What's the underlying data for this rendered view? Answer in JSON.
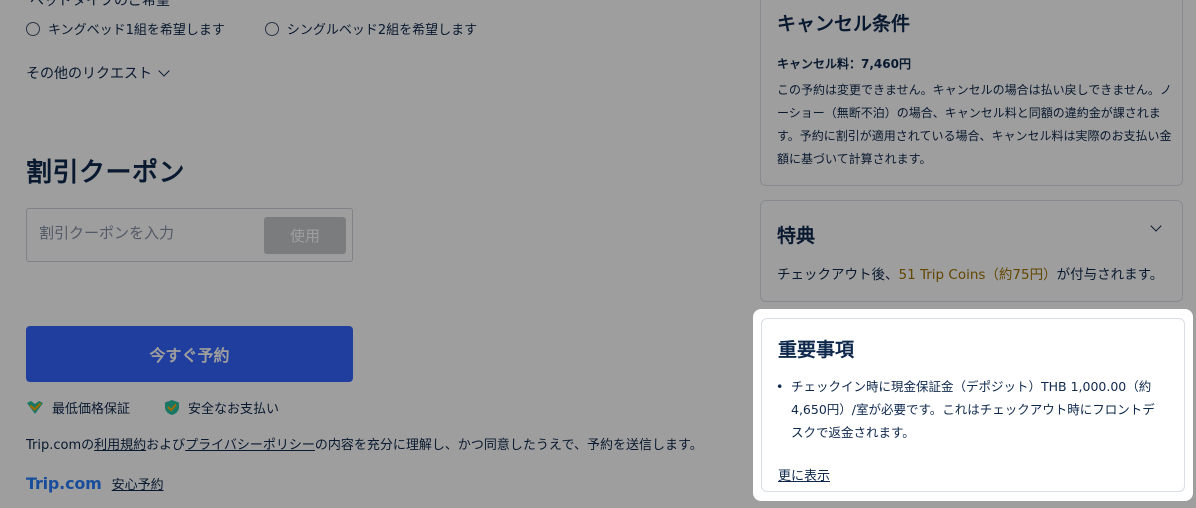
{
  "bed": {
    "heading_cut": "ベッドタイプのご希望",
    "options": [
      {
        "label": "キングベッド1組を希望します"
      },
      {
        "label": "シングルベッド2組を希望します"
      }
    ],
    "other_requests": "その他のリクエスト"
  },
  "coupon": {
    "title": "割引クーポン",
    "placeholder": "割引クーポンを入力",
    "apply_label": "使用"
  },
  "book": {
    "button_label": "今すぐ予約",
    "badges": [
      {
        "label": "最低価格保証",
        "icon": "heart-check-icon"
      },
      {
        "label": "安全なお支払い",
        "icon": "shield-check-icon"
      }
    ],
    "terms_prefix": "Trip.comの",
    "terms_link1": "利用規約",
    "terms_mid": "および",
    "terms_link2": "プライバシーポリシー",
    "terms_suffix": "の内容を充分に理解し、かつ同意したうえで、予約を送信します。",
    "brand": "Trip.com",
    "safe_link": "安心予約"
  },
  "cancel": {
    "title": "キャンセル条件",
    "fee": "キャンセル料：7,460円",
    "body": "この予約は変更できません。キャンセルの場合は払い戻しできません。ノーショー（無断不泊）の場合、キャンセル料と同額の違約金が課されます。予約に割引が適用されている場合、キャンセル料は実際のお支払い金額に基づいて計算されます。"
  },
  "perks": {
    "title": "特典",
    "prefix": "チェックアウト後、",
    "coins": "51 Trip Coins（約75円）",
    "suffix": "が付与されます。"
  },
  "important": {
    "title": "重要事項",
    "items": [
      {
        "text": "チェックイン時に現金保証金（デポジット）THB 1,000.00（約4,650円）/室が必要です。これはチェックアウト時にフロントデスクで返金されます。"
      }
    ],
    "show_more": "更に表示"
  },
  "colors": {
    "primary": "#3264ff",
    "text": "#0f294d",
    "coin": "#a17303",
    "brand": "#287dfa"
  }
}
